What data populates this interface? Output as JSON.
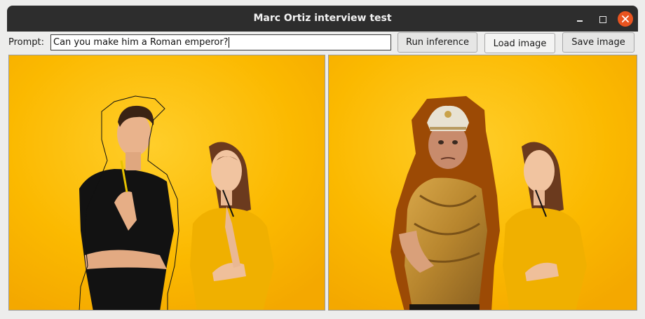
{
  "window": {
    "title": "Marc Ortiz interview test",
    "controls": [
      "minimize-icon",
      "maximize-icon",
      "close-icon"
    ]
  },
  "toolbar": {
    "prompt_label": "Prompt:",
    "prompt_value": "Can you make him a Roman emperor?",
    "run_label": "Run inference",
    "load_label": "Load image",
    "save_label": "Save image"
  },
  "colors": {
    "titlebar": "#2d2d2d",
    "close_button": "#e95420",
    "background_yellow": "#fbb800",
    "mask_brown": "#9c4a05"
  }
}
